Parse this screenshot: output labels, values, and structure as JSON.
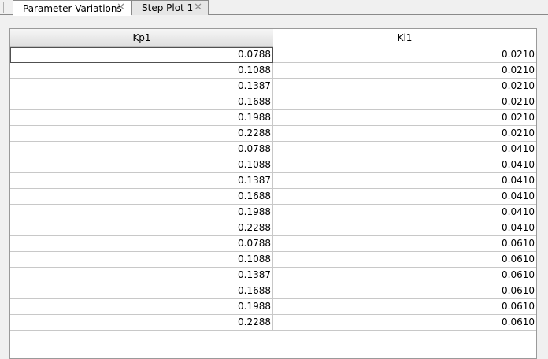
{
  "tabs": [
    {
      "label": "Parameter Variations",
      "close": "✕"
    },
    {
      "label": "Step Plot 1",
      "close": "✕"
    }
  ],
  "table": {
    "columns": [
      "Kp1",
      "Ki1"
    ],
    "rows": [
      [
        "0.0788",
        "0.0210"
      ],
      [
        "0.1088",
        "0.0210"
      ],
      [
        "0.1387",
        "0.0210"
      ],
      [
        "0.1688",
        "0.0210"
      ],
      [
        "0.1988",
        "0.0210"
      ],
      [
        "0.2288",
        "0.0210"
      ],
      [
        "0.0788",
        "0.0410"
      ],
      [
        "0.1088",
        "0.0410"
      ],
      [
        "0.1387",
        "0.0410"
      ],
      [
        "0.1688",
        "0.0410"
      ],
      [
        "0.1988",
        "0.0410"
      ],
      [
        "0.2288",
        "0.0410"
      ],
      [
        "0.0788",
        "0.0610"
      ],
      [
        "0.1088",
        "0.0610"
      ],
      [
        "0.1387",
        "0.0610"
      ],
      [
        "0.1688",
        "0.0610"
      ],
      [
        "0.1988",
        "0.0610"
      ],
      [
        "0.2288",
        "0.0610"
      ]
    ]
  }
}
